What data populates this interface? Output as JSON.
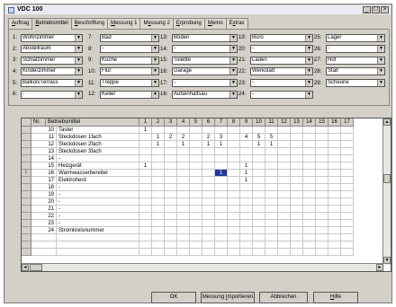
{
  "window": {
    "title": "VDC 100",
    "minimize": "_",
    "maximize": "□",
    "close": "×"
  },
  "tabs": [
    {
      "pre": "",
      "u": "A",
      "post": "uftrag"
    },
    {
      "pre": "",
      "u": "B",
      "post": "etriebsmittel"
    },
    {
      "pre": "",
      "u": "B",
      "post": "eschriftung"
    },
    {
      "pre": "",
      "u": "M",
      "post": "essung 1"
    },
    {
      "pre": "M",
      "u": "e",
      "post": "ssung 2"
    },
    {
      "pre": "",
      "u": "E",
      "post": "rprobung"
    },
    {
      "pre": "",
      "u": "M",
      "post": "emo"
    },
    {
      "pre": "E",
      "u": "x",
      "post": "tras"
    }
  ],
  "rooms": [
    [
      {
        "n": "1:",
        "v": "Wohnzimmer"
      },
      {
        "n": "2:",
        "v": "Abstellraum"
      },
      {
        "n": "3:",
        "v": "Schlafzimmer"
      },
      {
        "n": "4:",
        "v": "Kinderzimmer"
      },
      {
        "n": "5:",
        "v": "Balkon/Terrass"
      },
      {
        "n": "6:",
        "v": "-"
      }
    ],
    [
      {
        "n": "7:",
        "v": "Bad"
      },
      {
        "n": "8:",
        "v": "-"
      },
      {
        "n": "9:",
        "v": "Küche"
      },
      {
        "n": "10:",
        "v": "Flur"
      },
      {
        "n": "11:",
        "v": "Treppe"
      },
      {
        "n": "12:",
        "v": "Keller"
      }
    ],
    [
      {
        "n": "13:",
        "v": "Boden"
      },
      {
        "n": "14:",
        "v": "-"
      },
      {
        "n": "15:",
        "v": "Toilette"
      },
      {
        "n": "16:",
        "v": "Garage"
      },
      {
        "n": "17:",
        "v": "-"
      },
      {
        "n": "18:",
        "v": "Außenhaltsau"
      }
    ],
    [
      {
        "n": "19:",
        "v": "Büro"
      },
      {
        "n": "20:",
        "v": "-"
      },
      {
        "n": "21:",
        "v": "Laden"
      },
      {
        "n": "22:",
        "v": "Werkstatt"
      },
      {
        "n": "23:",
        "v": "-"
      },
      {
        "n": "24:",
        "v": "-"
      }
    ],
    [
      {
        "n": "25:",
        "v": "Lager"
      },
      {
        "n": "26:",
        "v": "-"
      },
      {
        "n": "27:",
        "v": "Hof"
      },
      {
        "n": "28:",
        "v": "Stall"
      },
      {
        "n": "29:",
        "v": "Scheune"
      }
    ]
  ],
  "grid": {
    "headers": [
      "Nr.",
      "Betriebsmittel",
      "1",
      "2",
      "3",
      "4",
      "5",
      "6",
      "7",
      "8",
      "9",
      "10",
      "11",
      "12",
      "13",
      "14",
      "15",
      "16",
      "17"
    ],
    "rows": [
      {
        "ind": "",
        "nr": "10",
        "name": "Taster",
        "vals": {
          "1": "1"
        }
      },
      {
        "ind": "",
        "nr": "11",
        "name": "Steckdosen 1fach",
        "vals": {
          "2": "1",
          "3": "2",
          "4": "2",
          "6": "2",
          "7": "3",
          "9": "4",
          "10": "5",
          "11": "5"
        }
      },
      {
        "ind": "",
        "nr": "12",
        "name": "Steckdosen 2fach",
        "vals": {
          "2": "1",
          "4": "1",
          "6": "1",
          "7": "1",
          "10": "1",
          "11": "1"
        }
      },
      {
        "ind": "",
        "nr": "13",
        "name": "Steckdosen 3fach",
        "vals": {}
      },
      {
        "ind": "",
        "nr": "14",
        "name": "-",
        "vals": {}
      },
      {
        "ind": "",
        "nr": "15",
        "name": "Heizgerät",
        "vals": {
          "1": "1",
          "9": "1"
        }
      },
      {
        "ind": "I",
        "nr": "16",
        "name": "Warmwasserbereiter",
        "vals": {
          "7": "1",
          "9": "1"
        }
      },
      {
        "ind": "",
        "nr": "17",
        "name": "Elektroherd",
        "vals": {
          "9": "1"
        }
      },
      {
        "ind": "",
        "nr": "18",
        "name": "-",
        "vals": {}
      },
      {
        "ind": "",
        "nr": "19",
        "name": "-",
        "vals": {}
      },
      {
        "ind": "",
        "nr": "20",
        "name": "-",
        "vals": {}
      },
      {
        "ind": "",
        "nr": "21",
        "name": "-",
        "vals": {}
      },
      {
        "ind": "",
        "nr": "22",
        "name": "-",
        "vals": {}
      },
      {
        "ind": "",
        "nr": "23",
        "name": "-",
        "vals": {}
      },
      {
        "ind": "",
        "nr": "24",
        "name": "Stromkreisnummer",
        "vals": {}
      },
      {
        "ind": "",
        "nr": "",
        "name": "",
        "vals": {}
      },
      {
        "ind": "",
        "nr": "",
        "name": "",
        "vals": {}
      },
      {
        "ind": "",
        "nr": "",
        "name": "",
        "vals": {}
      }
    ],
    "selected": {
      "row": "16",
      "col": "7"
    }
  },
  "footer": [
    {
      "pre": "OK",
      "u": "",
      "post": ""
    },
    {
      "pre": "Messung ",
      "u": "I",
      "post": "mportieren"
    },
    {
      "pre": "Abbrechen",
      "u": "",
      "post": ""
    },
    {
      "pre": "",
      "u": "H",
      "post": "ilfe"
    }
  ],
  "colors": {
    "window_bg": "#d4d0c8",
    "selection": "#1d3a9a",
    "titlebar": "#e8ecf2"
  }
}
